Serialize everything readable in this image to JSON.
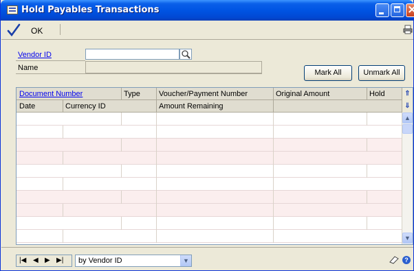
{
  "window": {
    "title": "Hold Payables Transactions"
  },
  "toolbar": {
    "ok_label": "OK"
  },
  "header": {
    "vendor_id_label": "Vendor ID",
    "vendor_id_value": "",
    "name_label": "Name",
    "name_value": ""
  },
  "buttons": {
    "mark_all": "Mark All",
    "unmark_all": "Unmark All"
  },
  "grid": {
    "header_row1": [
      "Document Number",
      "Type",
      "Voucher/Payment Number",
      "Original Amount",
      "Hold"
    ],
    "header_row2": [
      "Date",
      "Currency ID",
      "",
      "Amount Remaining",
      ""
    ],
    "row_count": 10
  },
  "footer": {
    "sort_value": "by Vendor ID"
  },
  "icons": {
    "ok": "check-icon",
    "print": "print-icon",
    "lookup": "magnifier-icon",
    "note": "note-icon",
    "help": "help-icon"
  },
  "colors": {
    "link": "#0000ee",
    "title_bar": "#0054e3",
    "alt_row": "#fbeeee"
  }
}
